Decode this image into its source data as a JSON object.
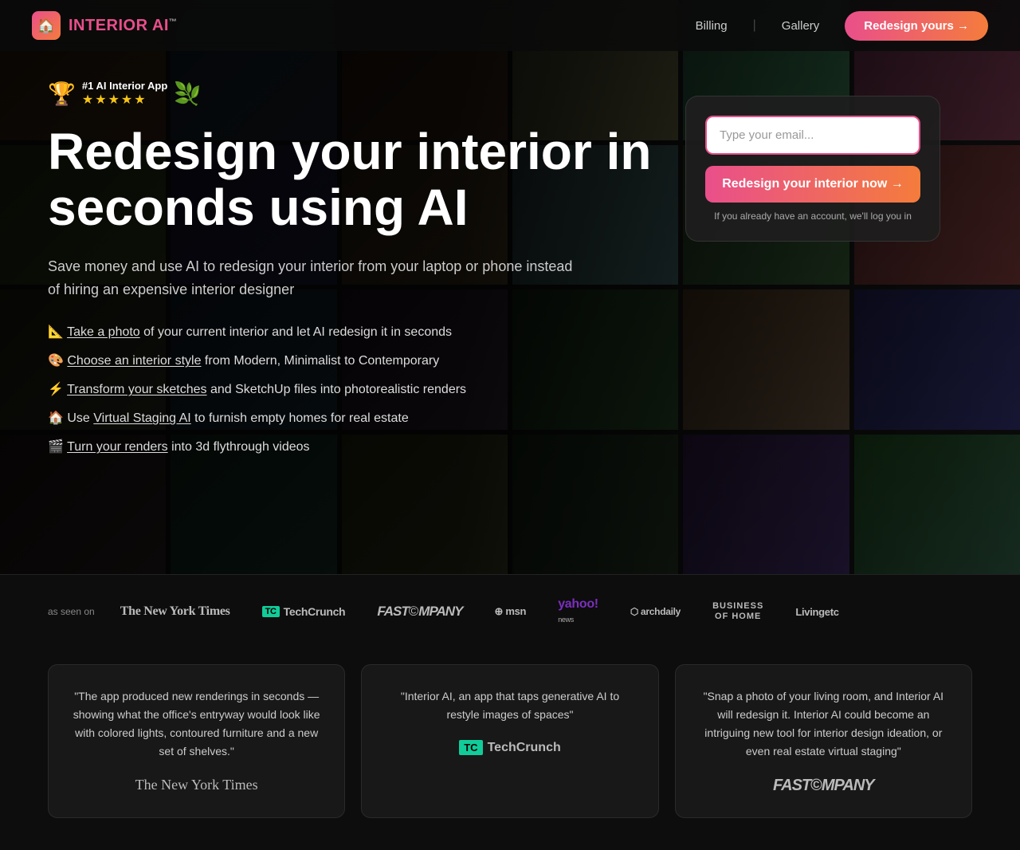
{
  "nav": {
    "logo_icon": "🏠",
    "logo_text_brand": "INTERIOR ",
    "logo_text_ai": "AI",
    "logo_tm": "™",
    "links": [
      {
        "label": "Billing",
        "href": "#"
      },
      {
        "label": "Gallery",
        "href": "#"
      }
    ],
    "cta_label": "Redesign yours →"
  },
  "hero": {
    "badge_title": "#1 AI Interior App",
    "badge_stars": "★★★★★",
    "heading_line1": "Redesign your interior in",
    "heading_line2": "seconds using AI",
    "subtitle": "Save money and use AI to redesign your interior from your laptop or phone instead of hiring an expensive interior designer",
    "features": [
      {
        "emoji": "📐",
        "text_linked": "Take a photo",
        "text_rest": " of your current interior and let AI redesign it in seconds"
      },
      {
        "emoji": "🎨",
        "text_linked": "Choose an interior style",
        "text_rest": " from Modern, Minimalist to Contemporary"
      },
      {
        "emoji": "⚡",
        "text_linked": "Transform your sketches",
        "text_rest": " and SketchUp files into photorealistic renders"
      },
      {
        "emoji": "🏠",
        "text_linked": "Virtual Staging AI",
        "text_prefix": "Use ",
        "text_rest": " to furnish empty homes for real estate"
      },
      {
        "emoji": "🎬",
        "text_linked": "Turn your renders",
        "text_rest": " into 3d flythrough videos"
      }
    ],
    "form": {
      "email_placeholder": "Type your email...",
      "cta_label": "Redesign your interior now →",
      "note": "If you already have an account, we'll log you in"
    }
  },
  "press": {
    "label": "as seen on",
    "logos": [
      {
        "name": "The New York Times",
        "style": "nyt"
      },
      {
        "name": "TechCrunch",
        "style": "tc"
      },
      {
        "name": "FAST COMPANY",
        "style": "fast"
      },
      {
        "name": "msn",
        "style": "msn"
      },
      {
        "name": "yahoo! news",
        "style": "yahoo"
      },
      {
        "name": "archdaily",
        "style": "archdaily"
      },
      {
        "name": "BUSINESS OF HOME",
        "style": "boh"
      },
      {
        "name": "Livingetc",
        "style": "livingetc"
      }
    ]
  },
  "testimonials": [
    {
      "quote": "\"The app produced new renderings in seconds — showing what the office's entryway would look like with colored lights, contoured furniture and a new set of shelves.\"",
      "source_label": "The New York Times",
      "source_style": "nyt"
    },
    {
      "quote": "\"Interior AI, an app that taps generative AI to restyle images of spaces\"",
      "source_label": "TechCrunch",
      "source_style": "tc"
    },
    {
      "quote": "\"Snap a photo of your living room, and Interior AI will redesign it. Interior AI could become an intriguing new tool for interior design ideation, or even real estate virtual staging\"",
      "source_label": "FAST COMPANY",
      "source_style": "fast"
    }
  ]
}
